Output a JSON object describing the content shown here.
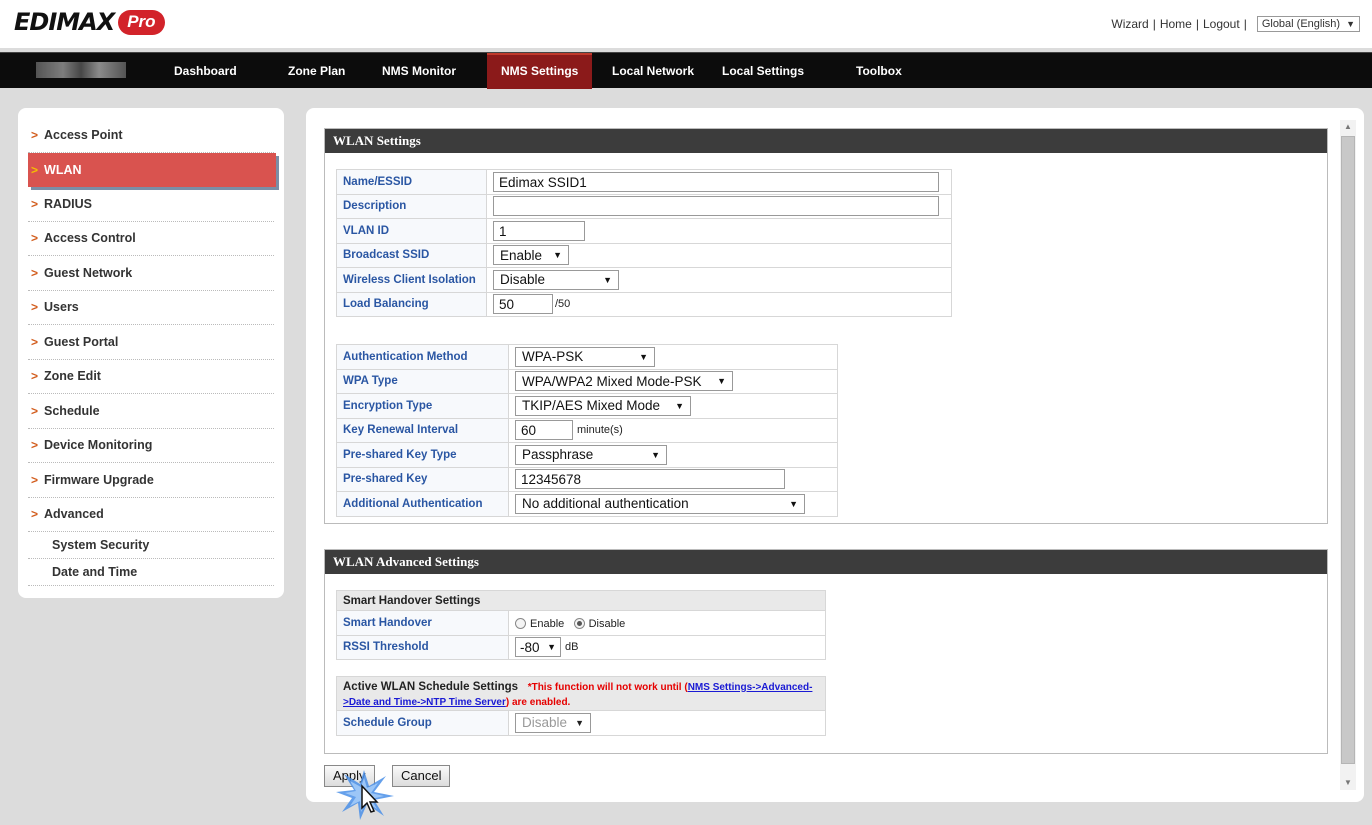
{
  "header": {
    "logo_text": "EDIMAX",
    "logo_badge": "Pro",
    "links": [
      "Wizard",
      "Home",
      "Logout"
    ],
    "language": "Global (English)"
  },
  "nav": {
    "items": [
      "Dashboard",
      "Zone Plan",
      "NMS Monitor",
      "NMS Settings",
      "Local Network",
      "Local Settings",
      "Toolbox"
    ],
    "active": "NMS Settings"
  },
  "sidebar": {
    "items": [
      "Access Point",
      "WLAN",
      "RADIUS",
      "Access Control",
      "Guest Network",
      "Users",
      "Guest Portal",
      "Zone Edit",
      "Schedule",
      "Device Monitoring",
      "Firmware Upgrade",
      "Advanced"
    ],
    "active": "WLAN",
    "subitems": [
      "System Security",
      "Date and Time"
    ]
  },
  "wlan_settings": {
    "title": "WLAN Settings",
    "name_essid": {
      "label": "Name/ESSID",
      "value": "Edimax SSID1"
    },
    "description": {
      "label": "Description",
      "value": ""
    },
    "vlan_id": {
      "label": "VLAN ID",
      "value": "1"
    },
    "broadcast_ssid": {
      "label": "Broadcast SSID",
      "value": "Enable"
    },
    "client_isolation": {
      "label": "Wireless Client Isolation",
      "value": "Disable"
    },
    "load_balancing": {
      "label": "Load Balancing",
      "value": "50",
      "suffix": "/50"
    },
    "auth_method": {
      "label": "Authentication Method",
      "value": "WPA-PSK"
    },
    "wpa_type": {
      "label": "WPA Type",
      "value": "WPA/WPA2 Mixed Mode-PSK"
    },
    "encryption_type": {
      "label": "Encryption Type",
      "value": "TKIP/AES Mixed Mode"
    },
    "key_renewal": {
      "label": "Key Renewal Interval",
      "value": "60",
      "unit": "minute(s)"
    },
    "psk_type": {
      "label": "Pre-shared Key Type",
      "value": "Passphrase"
    },
    "psk": {
      "label": "Pre-shared Key",
      "value": "12345678"
    },
    "additional_auth": {
      "label": "Additional Authentication",
      "value": "No additional authentication"
    }
  },
  "wlan_advanced": {
    "title": "WLAN Advanced Settings",
    "smart_handover_header": "Smart Handover Settings",
    "smart_handover": {
      "label": "Smart Handover",
      "opt_enable": "Enable",
      "opt_disable": "Disable",
      "selected": "Disable"
    },
    "rssi": {
      "label": "RSSI Threshold",
      "value": "-80",
      "unit": "dB"
    },
    "schedule_header": "Active WLAN Schedule Settings",
    "schedule_warn_pre": "*This function will not work until (",
    "schedule_warn_link": "NMS Settings->Advanced->Date and Time->NTP Time Server",
    "schedule_warn_post": ") are enabled.",
    "schedule_group": {
      "label": "Schedule Group",
      "value": "Disable"
    }
  },
  "buttons": {
    "apply": "Apply",
    "cancel": "Cancel"
  }
}
